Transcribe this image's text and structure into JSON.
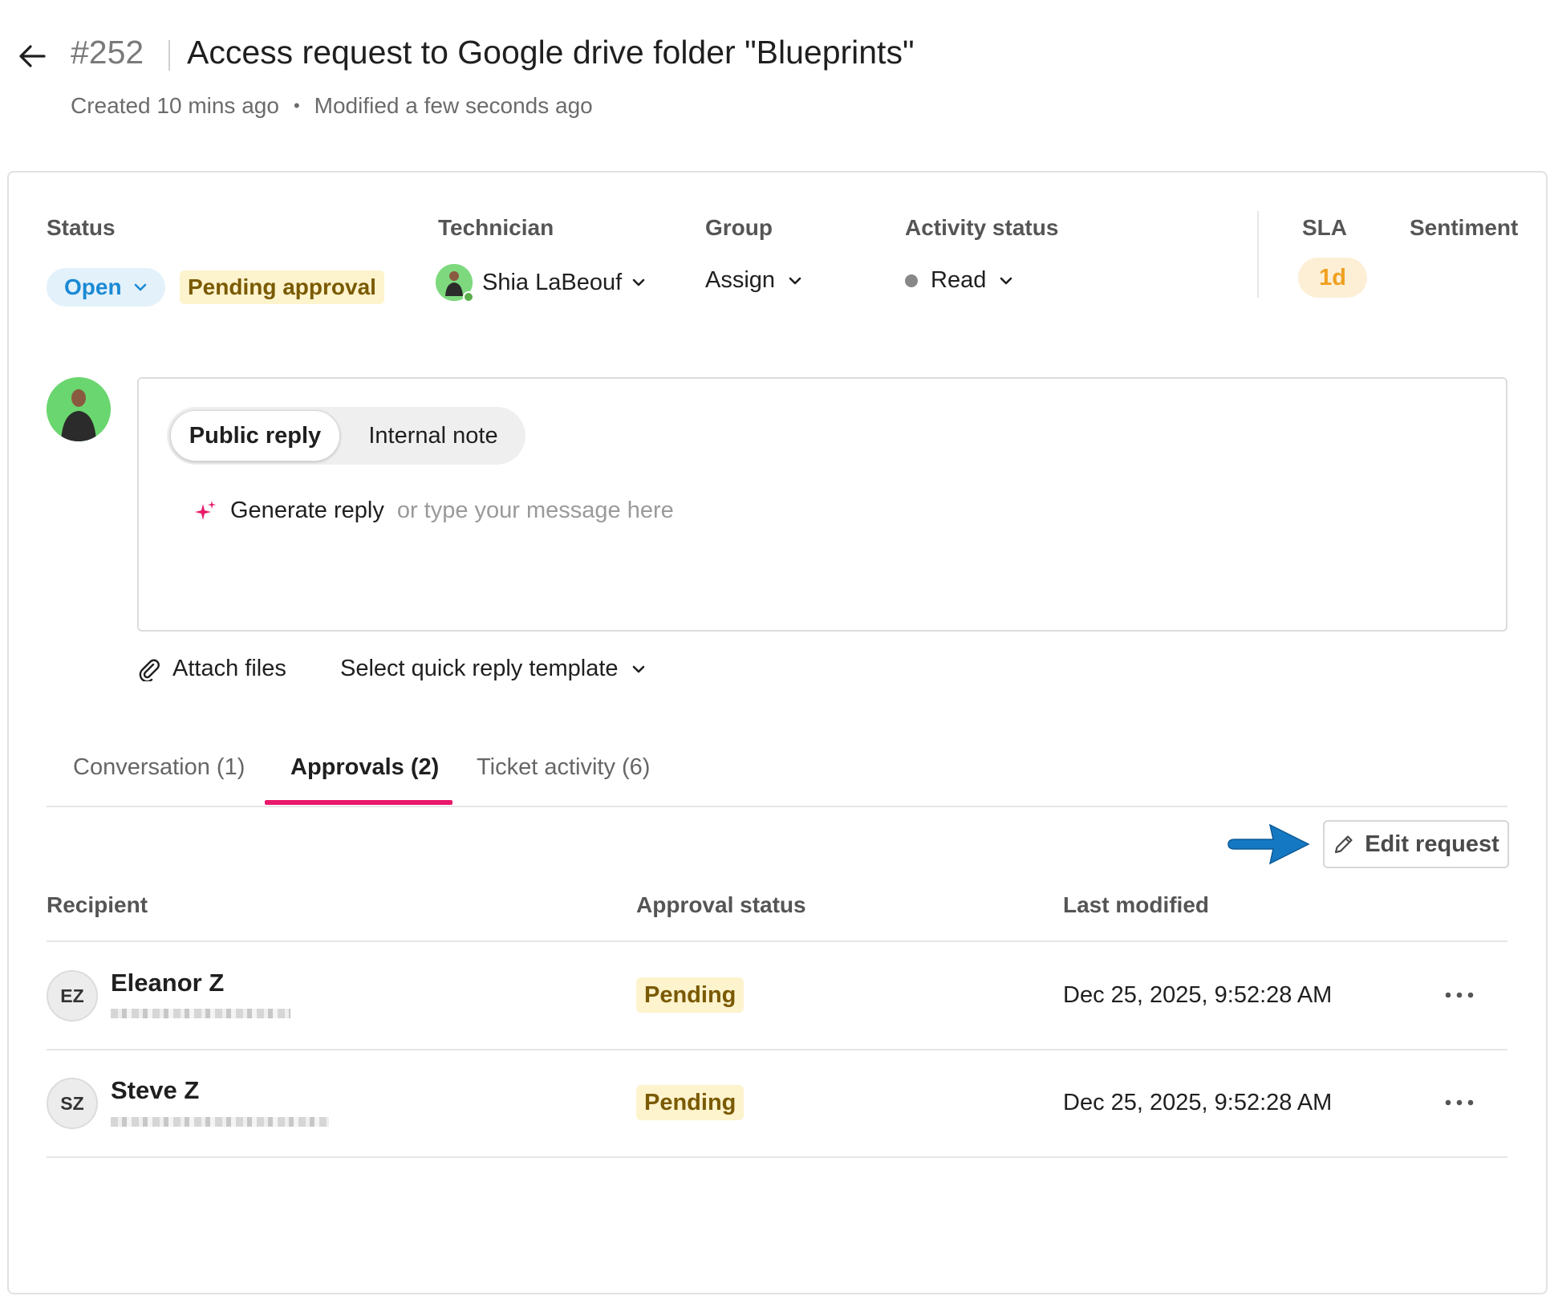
{
  "header": {
    "ticket_id": "#252",
    "title": "Access request to Google drive folder \"Blueprints\"",
    "created": "Created 10 mins ago",
    "modified": "Modified a few seconds ago"
  },
  "fields": {
    "status_label": "Status",
    "status_value": "Open",
    "pending_approval": "Pending approval",
    "technician_label": "Technician",
    "technician_value": "Shia LaBeouf",
    "group_label": "Group",
    "group_value": "Assign",
    "activity_label": "Activity status",
    "activity_value": "Read",
    "sla_label": "SLA",
    "sla_value": "1d",
    "sentiment_label": "Sentiment"
  },
  "reply": {
    "public_reply": "Public reply",
    "internal_note": "Internal note",
    "generate_reply": "Generate reply",
    "placeholder": "or type your message here",
    "attach_files": "Attach files",
    "quick_reply": "Select quick reply template"
  },
  "tabs": [
    {
      "label": "Conversation (1)",
      "active": false
    },
    {
      "label": "Approvals (2)",
      "active": true
    },
    {
      "label": "Ticket activity (6)",
      "active": false
    }
  ],
  "approvals": {
    "edit_button": "Edit request",
    "columns": [
      "Recipient",
      "Approval status",
      "Last modified"
    ],
    "rows": [
      {
        "initials": "EZ",
        "name": "Eleanor Z",
        "status": "Pending",
        "modified": "Dec 25, 2025, 9:52:28 AM"
      },
      {
        "initials": "SZ",
        "name": "Steve Z",
        "status": "Pending",
        "modified": "Dec 25, 2025, 9:52:28 AM"
      }
    ]
  },
  "colors": {
    "accent_pink": "#e8196b",
    "status_blue": "#1a8ad4",
    "pending_bg": "#fdf3cd",
    "sla_orange": "#f0a020",
    "annotation_arrow": "#1578c2"
  },
  "icons": {
    "back": "arrow-left-icon",
    "chevron": "chevron-down-icon",
    "sparkle": "sparkle-icon",
    "attach": "paperclip-icon",
    "edit": "pencil-icon",
    "more": "more-horizontal-icon"
  }
}
